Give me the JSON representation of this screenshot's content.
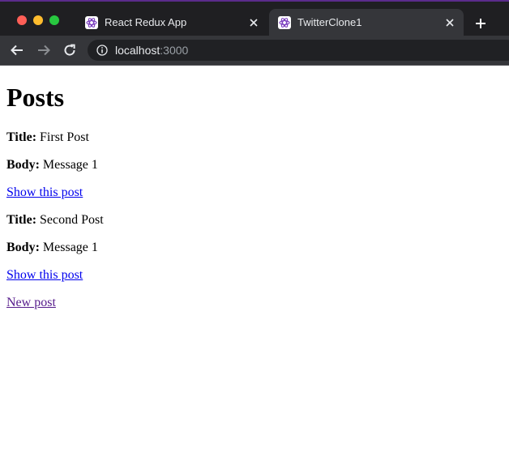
{
  "browser": {
    "tabs": [
      {
        "title": "React Redux App",
        "active": false
      },
      {
        "title": "TwitterClone1",
        "active": true
      }
    ],
    "url": {
      "host": "localhost",
      "port": ":3000"
    }
  },
  "page": {
    "heading": "Posts",
    "posts": [
      {
        "title_label": "Title:",
        "title": "First Post",
        "body_label": "Body:",
        "body": "Message 1",
        "link": "Show this post"
      },
      {
        "title_label": "Title:",
        "title": "Second Post",
        "body_label": "Body:",
        "body": "Message 1",
        "link": "Show this post"
      }
    ],
    "new_post_link": "New post"
  },
  "colors": {
    "link": "#0000ee",
    "visited_link": "#551a8b",
    "chrome_bg": "#202124",
    "active_tab": "#35363a"
  }
}
